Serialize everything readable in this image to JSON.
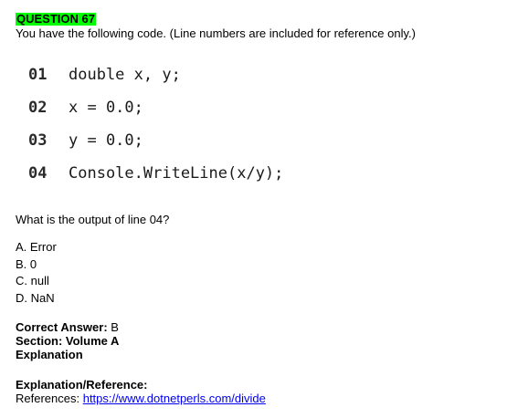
{
  "question": {
    "heading": "QUESTION 67",
    "intro": "You have the following code. (Line numbers are included for reference only.)",
    "code_lines": [
      {
        "number": "01",
        "code": "double x, y;"
      },
      {
        "number": "02",
        "code": "x = 0.0;"
      },
      {
        "number": "03",
        "code": "y = 0.0;"
      },
      {
        "number": "04",
        "code": "Console.WriteLine(x/y);"
      }
    ],
    "prompt": "What is the output of line 04?",
    "options": [
      {
        "letter": "A.",
        "text": "Error"
      },
      {
        "letter": "B.",
        "text": "0"
      },
      {
        "letter": "C.",
        "text": "null"
      },
      {
        "letter": "D.",
        "text": "NaN"
      }
    ]
  },
  "answer": {
    "correct_label": "Correct Answer:",
    "correct_value": "B",
    "section": "Section: Volume A",
    "explanation_heading": "Explanation"
  },
  "reference": {
    "heading": "Explanation/Reference:",
    "label": "References:",
    "link_text": "https://www.dotnetperls.com/divide"
  },
  "colors": {
    "heading_highlight": "#00ff00",
    "link": "#0000ee"
  }
}
